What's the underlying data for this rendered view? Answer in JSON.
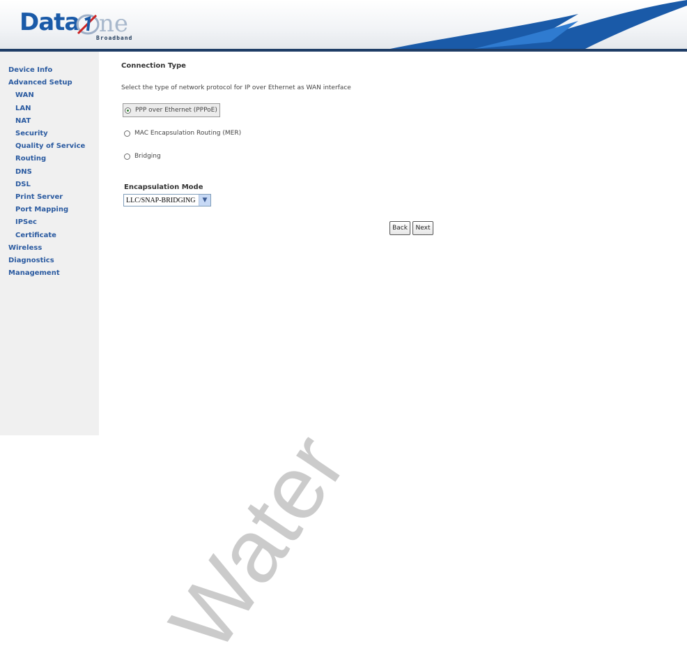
{
  "header": {
    "logo_word": "Data",
    "logo_word2": "ne",
    "logo_sub": "Broadband"
  },
  "sidebar": {
    "items": [
      {
        "label": "Device Info",
        "level": 0
      },
      {
        "label": "Advanced Setup",
        "level": 0
      },
      {
        "label": "WAN",
        "level": 1
      },
      {
        "label": "LAN",
        "level": 1
      },
      {
        "label": "NAT",
        "level": 1
      },
      {
        "label": "Security",
        "level": 1
      },
      {
        "label": "Quality of Service",
        "level": 1
      },
      {
        "label": "Routing",
        "level": 1
      },
      {
        "label": "DNS",
        "level": 1
      },
      {
        "label": "DSL",
        "level": 1
      },
      {
        "label": "Print Server",
        "level": 1
      },
      {
        "label": "Port Mapping",
        "level": 1
      },
      {
        "label": "IPSec",
        "level": 1
      },
      {
        "label": "Certificate",
        "level": 1
      },
      {
        "label": "Wireless",
        "level": 0
      },
      {
        "label": "Diagnostics",
        "level": 0
      },
      {
        "label": "Management",
        "level": 0
      }
    ]
  },
  "main": {
    "title": "Connection Type",
    "description": "Select the type of network protocol for IP over Ethernet as WAN interface",
    "options": [
      {
        "label": "PPP over Ethernet (PPPoE)",
        "checked": true
      },
      {
        "label": "MAC Encapsulation Routing (MER)",
        "checked": false
      },
      {
        "label": "Bridging",
        "checked": false
      }
    ],
    "encapsulation_label": "Encapsulation Mode",
    "encapsulation_value": "LLC/SNAP-BRIDGING",
    "back_label": "Back",
    "next_label": "Next"
  },
  "watermark": "Water",
  "colors": {
    "nav_link": "#2a5aa0",
    "header_bar": "#1f3d66",
    "logo_blue": "#1a5aa8"
  }
}
